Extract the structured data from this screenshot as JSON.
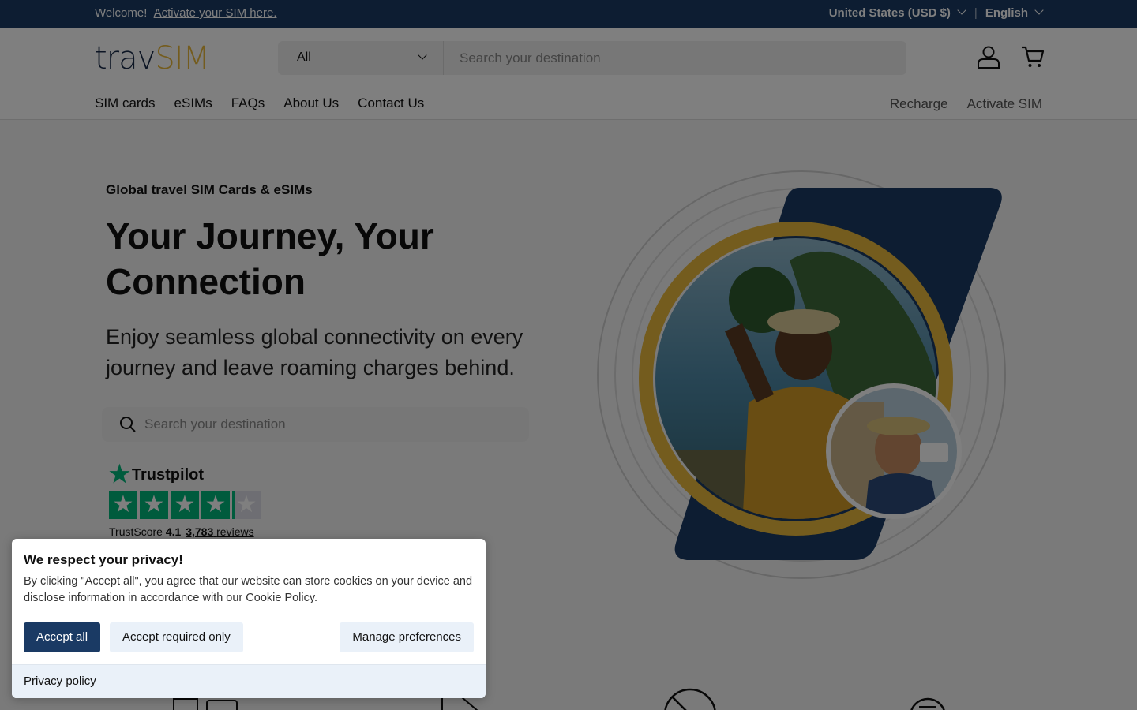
{
  "topbar": {
    "welcome": "Welcome!",
    "activate_link": "Activate your SIM here.",
    "currency": "United States (USD $)",
    "separator": "|",
    "language": "English"
  },
  "header": {
    "logo_part1": "trav",
    "logo_part2": "SIM",
    "category": "All",
    "search_placeholder": "Search your destination",
    "account_icon": "user-icon",
    "cart_icon": "cart-icon",
    "nav": [
      "SIM cards",
      "eSIMs",
      "FAQs",
      "About Us",
      "Contact Us"
    ],
    "subnav": [
      "Recharge",
      "Activate SIM"
    ]
  },
  "hero": {
    "eyebrow": "Global travel SIM Cards & eSIMs",
    "title": "Your Journey, Your Connection",
    "subtitle": "Enjoy seamless global connectivity on every journey and leave roaming charges behind.",
    "search_placeholder": "Search your destination"
  },
  "trustpilot": {
    "brand": "Trustpilot",
    "score_label": "TrustScore",
    "score": "4.1",
    "reviews_count": "3,783",
    "reviews_label": "reviews",
    "stars_rating": 4.1
  },
  "cookie": {
    "title": "We respect your privacy!",
    "body": "By clicking \"Accept all\", you agree that our website can store cookies on your device and disclose information in accordance with our Cookie Policy.",
    "accept_all": "Accept all",
    "accept_required": "Accept required only",
    "manage": "Manage preferences",
    "privacy": "Privacy policy"
  },
  "colors": {
    "navy": "#1a3a64",
    "gold": "#e9b93c",
    "trustpilot_green": "#00b67a"
  }
}
